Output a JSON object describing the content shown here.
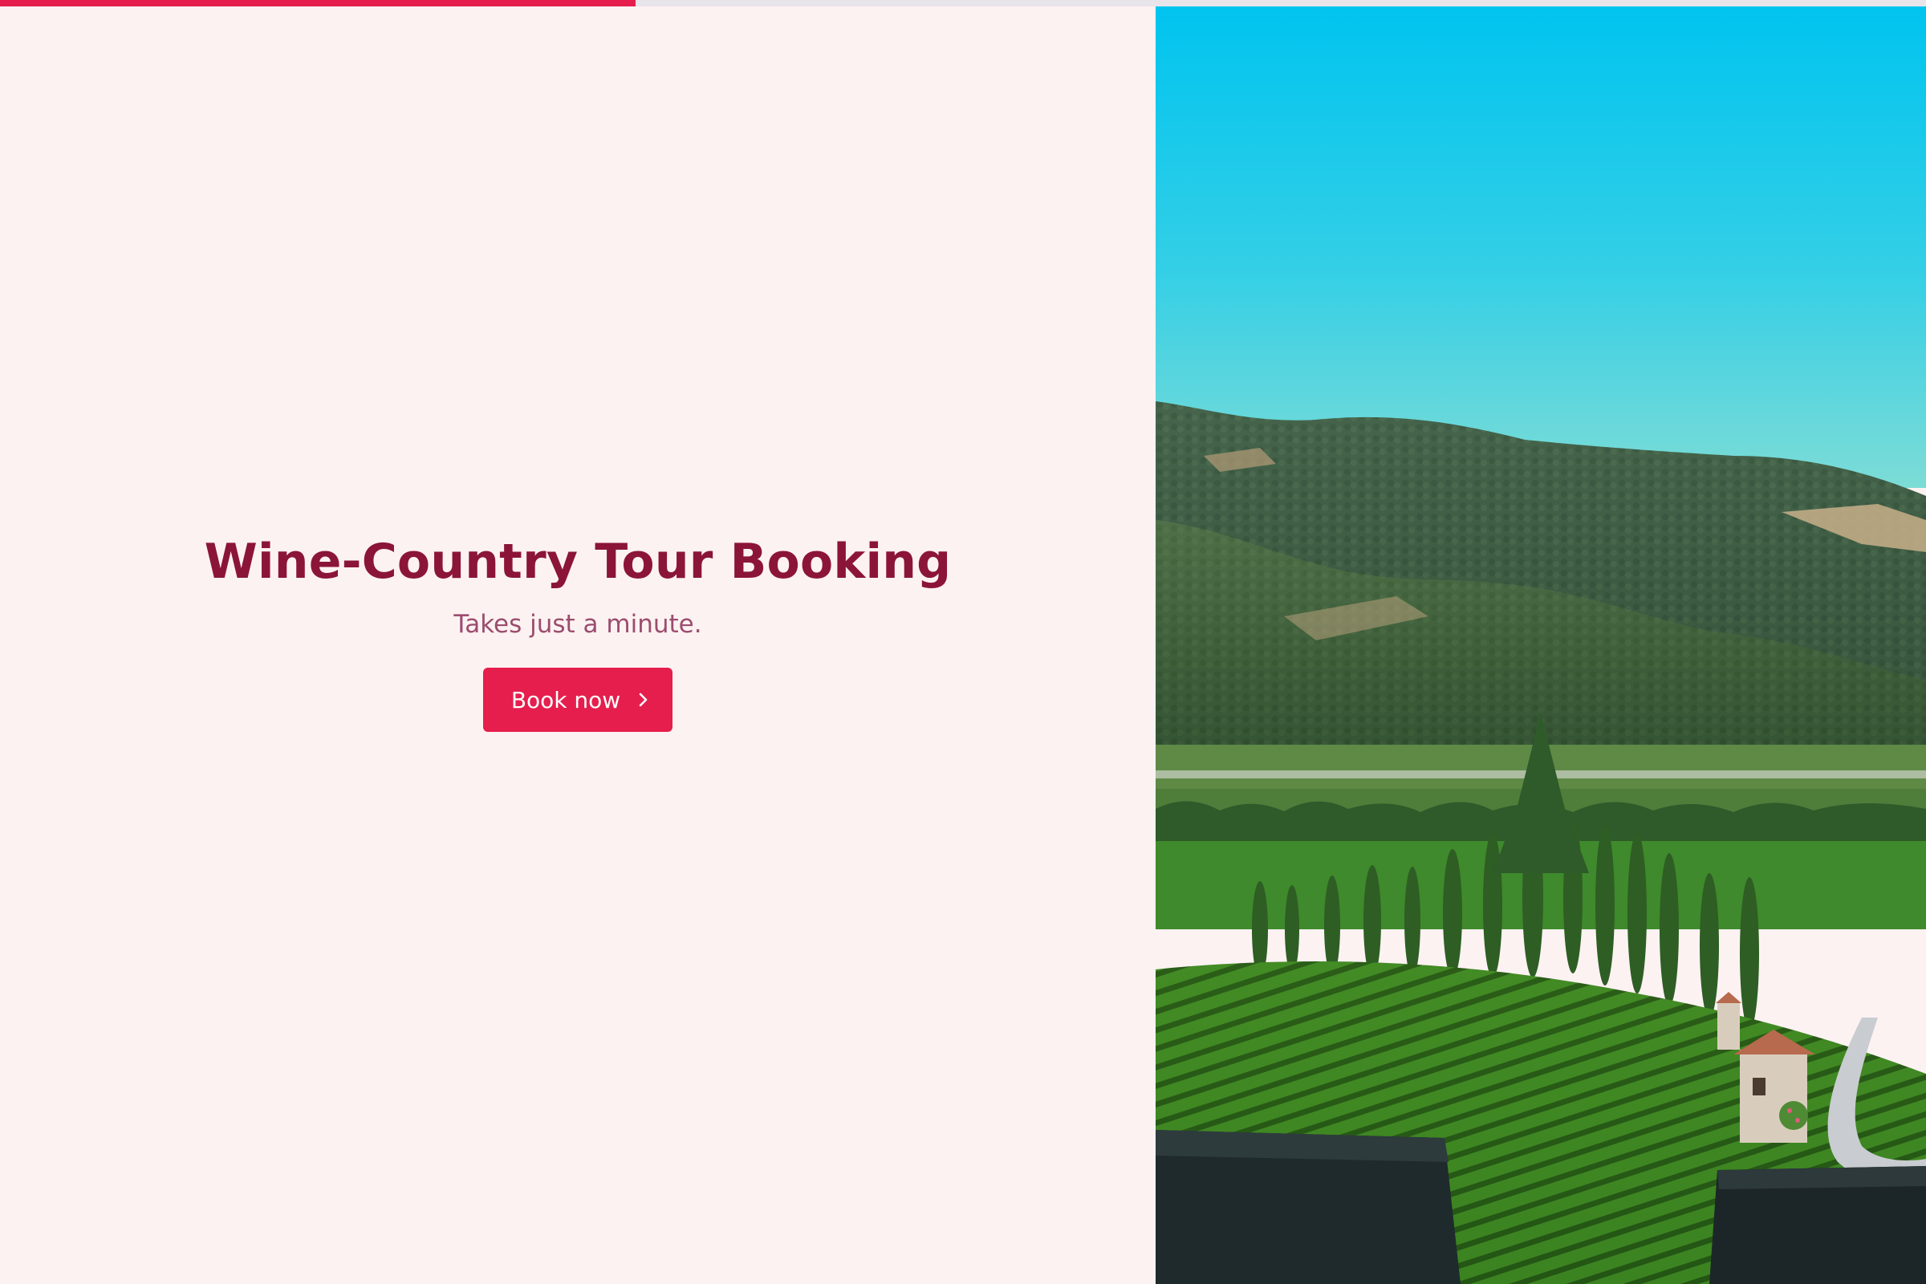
{
  "progress": {
    "fraction": 0.33
  },
  "hero": {
    "title": "Wine-Country Tour Booking",
    "subtitle": "Takes just a minute.",
    "cta_label": "Book now",
    "cta_icon": "chevron-right-icon"
  },
  "colors": {
    "background": "#fdf2f2",
    "accent": "#e51e4d",
    "title": "#8b1538",
    "subtitle": "#9b4d6e",
    "progress_track": "#e7e5ea"
  },
  "image": {
    "subject": "vineyard-landscape-photo"
  }
}
